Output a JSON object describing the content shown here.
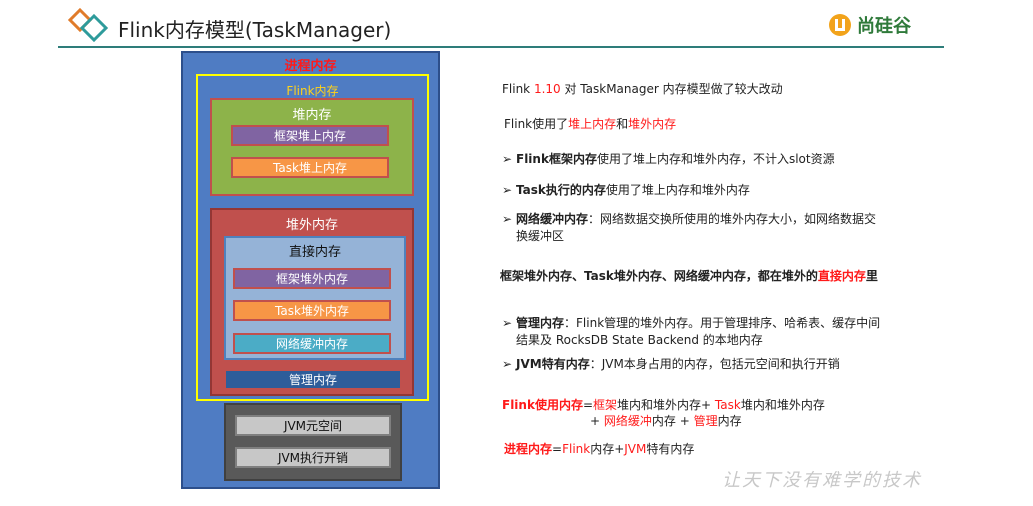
{
  "header": {
    "title": "Flink内存模型(TaskManager)",
    "brand": "尚硅谷"
  },
  "diagram": {
    "process_memory": "进程内存",
    "flink_memory": "Flink内存",
    "heap": "堆内存",
    "framework_heap": "框架堆上内存",
    "task_heap": "Task堆上内存",
    "off_heap": "堆外内存",
    "direct": "直接内存",
    "framework_off_heap": "框架堆外内存",
    "task_off_heap": "Task堆外内存",
    "network": "网络缓冲内存",
    "managed": "管理内存",
    "jvm_metaspace": "JVM元空间",
    "jvm_overhead": "JVM执行开销"
  },
  "notes": {
    "line1": {
      "a": "Flink ",
      "b": "1.10",
      "c": " 对 TaskManager 内存模型做了较大改动"
    },
    "line2": {
      "a": "Flink使用了",
      "b": "堆上内存",
      "c": "和",
      "d": "堆外内存"
    },
    "bullet1": {
      "arrow": "➢",
      "bold": "Flink框架内存",
      "rest": "使用了堆上内存和堆外内存，不计入slot资源"
    },
    "bullet2": {
      "arrow": "➢",
      "bold": "Task执行的内存",
      "rest": "使用了堆上内存和堆外内存"
    },
    "bullet3": {
      "arrow": "➢",
      "bold": "网络缓冲内存",
      "rest": "：网络数据交换所使用的堆外内存大小，如网络数据交",
      "rest2": "换缓冲区"
    },
    "summary": {
      "a": "框架堆外内存、Task堆外内存、网络缓冲内存，都在堆外的",
      "b": "直接内存",
      "c": "里"
    },
    "bullet4": {
      "arrow": "➢",
      "bold": "管理内存",
      "rest": "：Flink管理的堆外内存。用于管理排序、哈希表、缓存中间",
      "rest2": "结果及 RocksDB State Backend 的本地内存"
    },
    "bullet5": {
      "arrow": "➢",
      "bold": "JVM特有内存",
      "rest": "：JVM本身占用的内存，包括元空间和执行开销"
    },
    "formula1": {
      "a": "Flink使用内存",
      "b": "=",
      "c": "框架",
      "d": "堆内和堆外内存+ ",
      "e": "Task",
      "f": "堆内和堆外内存"
    },
    "formula1b": {
      "a": "+ ",
      "b": "网络缓冲",
      "c": "内存 + ",
      "d": "管理",
      "e": "内存"
    },
    "formula2": {
      "a": "进程内存",
      "b": "=",
      "c": "Flink",
      "d": "内存+",
      "e": "JVM",
      "f": "特有内存"
    }
  },
  "watermark": "让天下没有难学的技术",
  "colors": {
    "accent_red": "#ff1a1a",
    "header_line": "#2e7d7a",
    "brand_green": "#2f7a3a"
  }
}
